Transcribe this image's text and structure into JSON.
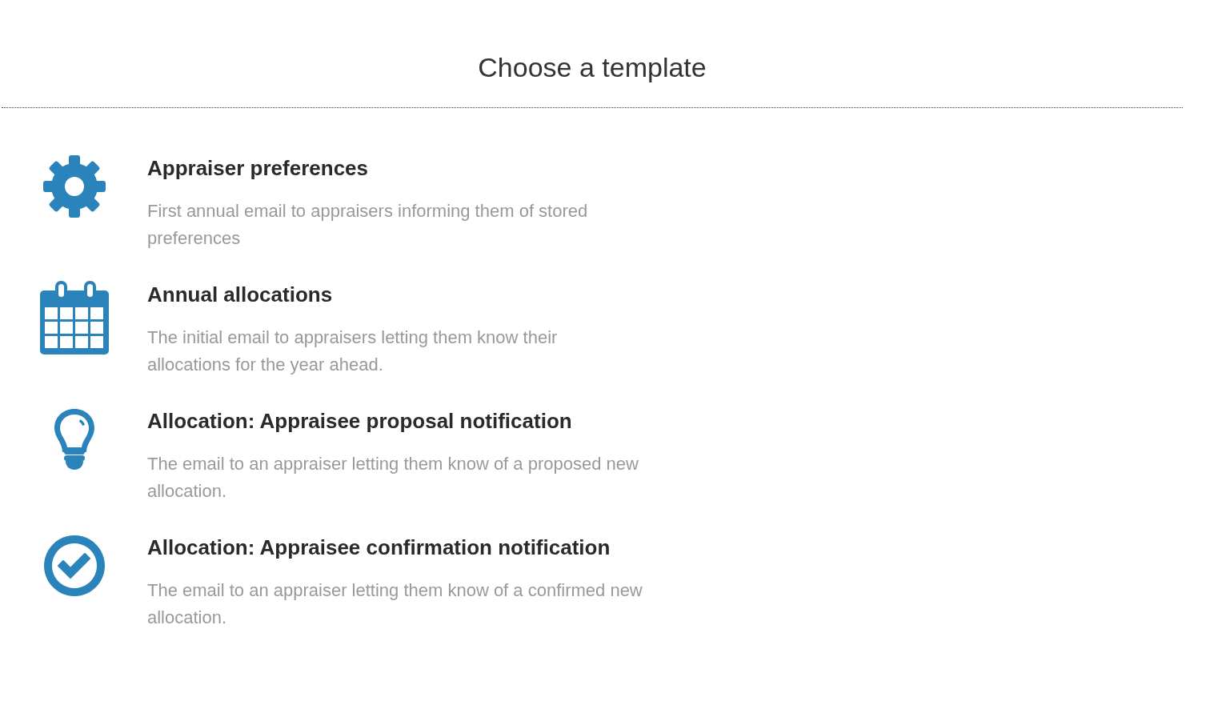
{
  "title": "Choose a template",
  "templates": [
    {
      "kind": "gear",
      "name": "Appraiser preferences",
      "description": "First annual email to appraisers informing them of stored preferences"
    },
    {
      "kind": "calendar",
      "name": "Annual allocations",
      "description": "The initial email to appraisers letting them know their allocations for the year ahead."
    },
    {
      "kind": "bulb",
      "name": "Allocation: Appraisee proposal notification",
      "description": "The email to an appraiser letting them know of a proposed new allocation."
    },
    {
      "kind": "check",
      "name": "Allocation: Appraisee confirmation notification",
      "description": "The email to an appraiser letting them know of a confirmed new allocation."
    }
  ]
}
